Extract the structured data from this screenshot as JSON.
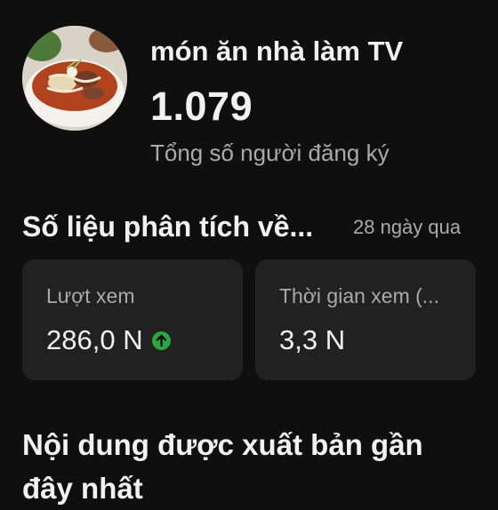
{
  "channel": {
    "name": "món ăn nhà làm TV",
    "subscriber_count": "1.079",
    "subscriber_label": "Tổng số người đăng ký",
    "avatar_icon": "pho-bowl-avatar"
  },
  "analytics": {
    "title": "Số liệu phân tích về...",
    "period": "28 ngày qua",
    "cards": [
      {
        "label": "Lượt xem",
        "value": "286,0 N",
        "trend_icon": "arrow-up-icon",
        "trend_color": "#2ba640"
      },
      {
        "label": "Thời gian xem (...",
        "value": "3,3 N"
      }
    ]
  },
  "recent": {
    "title": "Nội dung được xuất bản gần đây nhất"
  }
}
